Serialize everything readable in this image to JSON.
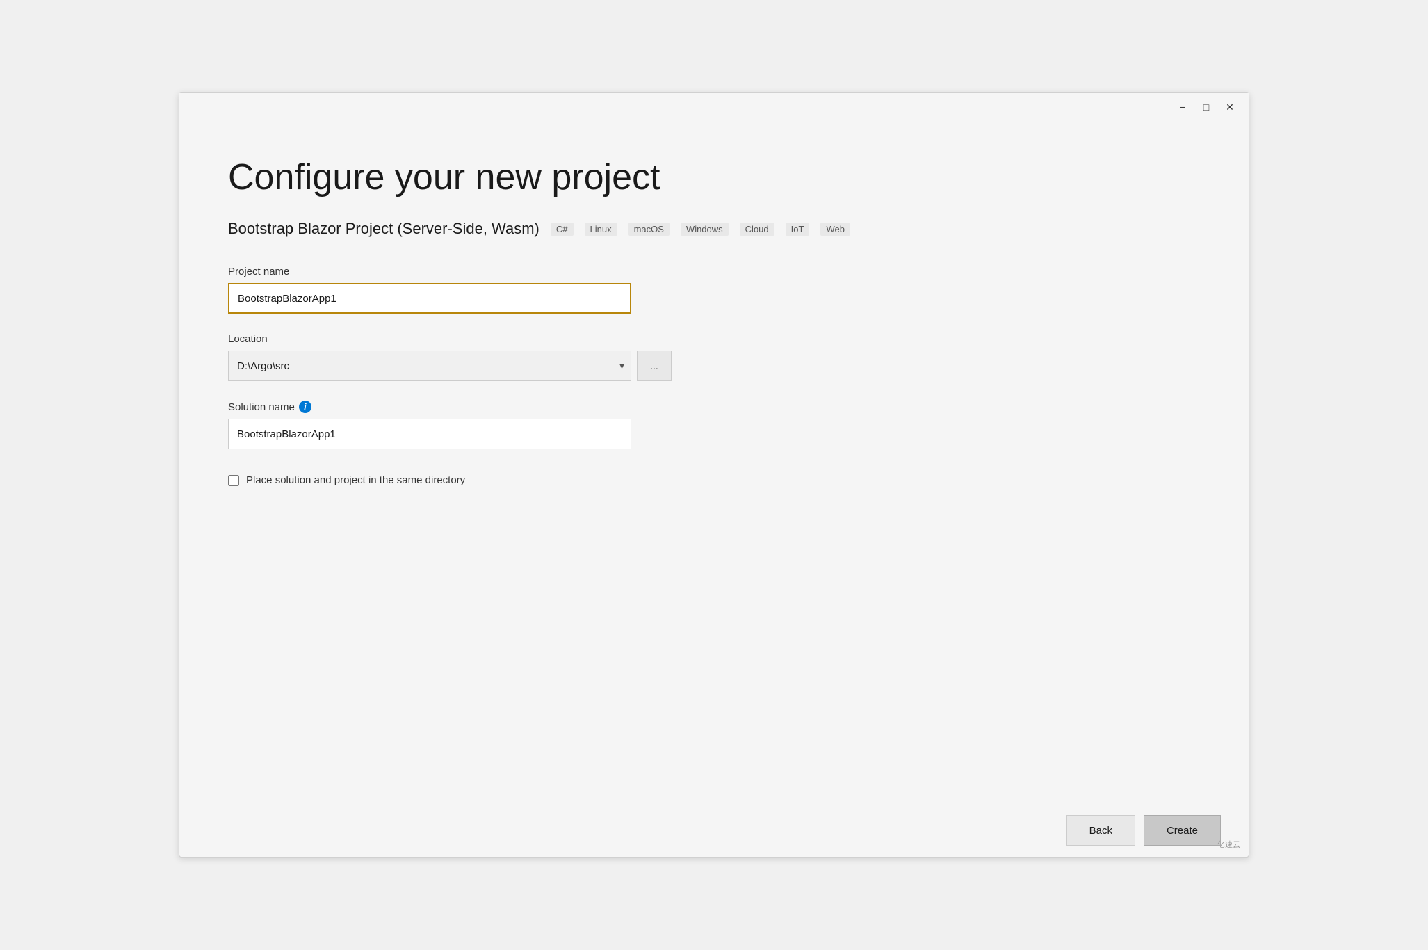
{
  "window": {
    "title": "Configure your new project"
  },
  "titlebar": {
    "minimize_label": "−",
    "maximize_label": "□",
    "close_label": "✕"
  },
  "page": {
    "heading": "Configure your new project",
    "project_type": {
      "name": "Bootstrap Blazor Project (Server-Side, Wasm)",
      "tags": [
        "C#",
        "Linux",
        "macOS",
        "Windows",
        "Cloud",
        "IoT",
        "Web"
      ]
    },
    "form": {
      "project_name_label": "Project name",
      "project_name_value": "BootstrapBlazorApp1",
      "location_label": "Location",
      "location_value": "D:\\Argo\\src",
      "solution_name_label": "Solution name",
      "solution_name_value": "BootstrapBlazorApp1",
      "checkbox_label": "Place solution and project in the same directory",
      "browse_btn_label": "..."
    },
    "footer": {
      "back_label": "Back",
      "create_label": "Create"
    }
  },
  "watermark": {
    "text": "亿速云"
  }
}
